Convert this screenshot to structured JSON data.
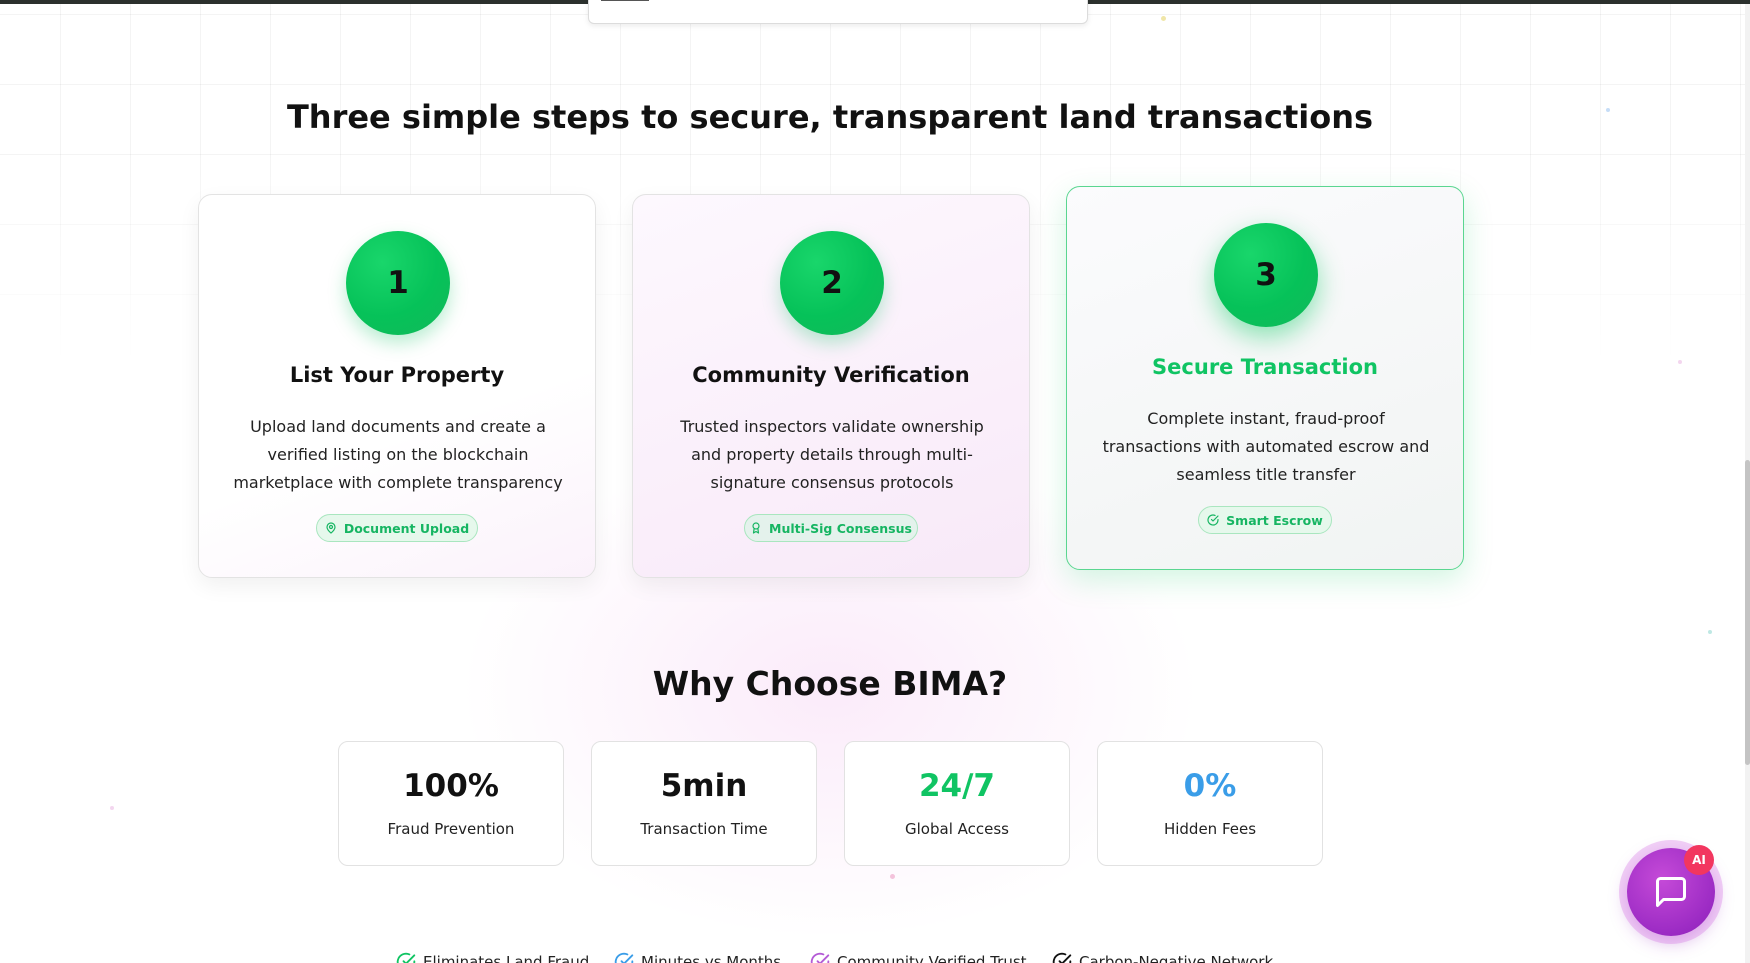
{
  "steps_section": {
    "title": "Three simple steps to secure, transparent land transactions",
    "steps": [
      {
        "number": "1",
        "title": "List Your Property",
        "description": "Upload land documents and create a verified listing on the blockchain marketplace with complete transparency",
        "badge": "Document Upload",
        "badge_icon": "map-pin-icon"
      },
      {
        "number": "2",
        "title": "Community Verification",
        "description": "Trusted inspectors validate ownership and property details through multi-signature consensus protocols",
        "badge": "Multi-Sig Consensus",
        "badge_icon": "award-icon"
      },
      {
        "number": "3",
        "title": "Secure Transaction",
        "description": "Complete instant, fraud-proof transactions with automated escrow and seamless title transfer",
        "badge": "Smart Escrow",
        "badge_icon": "check-circle-icon"
      }
    ]
  },
  "why_section": {
    "title": "Why Choose BIMA?",
    "stats": [
      {
        "value": "100%",
        "label": "Fraud Prevention",
        "color": "#111111"
      },
      {
        "value": "5min",
        "label": "Transaction Time",
        "color": "#111111"
      },
      {
        "value": "24/7",
        "label": "Global Access",
        "color": "#10c463"
      },
      {
        "value": "0%",
        "label": "Hidden Fees",
        "color": "#3a9de8"
      }
    ],
    "benefits": [
      {
        "label": "Eliminates Land Fraud",
        "color": "#10c463"
      },
      {
        "label": "Minutes vs Months",
        "color": "#3a9de8"
      },
      {
        "label": "Community Verified Trust",
        "color": "#b45bd6"
      },
      {
        "label": "Carbon-Negative Network",
        "color": "#111111"
      }
    ]
  },
  "chat_widget": {
    "badge": "AI",
    "icon": "message-square-icon"
  },
  "colors": {
    "accent_green": "#10c463",
    "accent_blue": "#3a9de8",
    "accent_purple": "#9c2bc4",
    "notification_red": "#f2365f"
  }
}
